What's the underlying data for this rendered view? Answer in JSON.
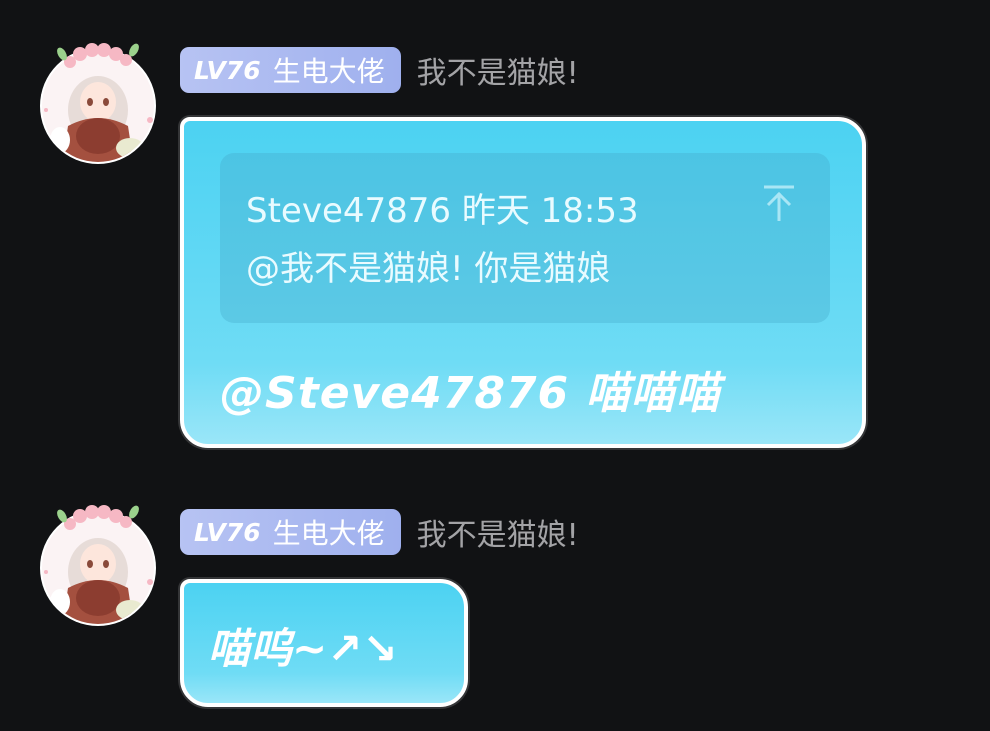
{
  "messages": [
    {
      "sender": {
        "level": "LV76",
        "title": "生电大佬",
        "name": "我不是猫娘!"
      },
      "quote": {
        "author": "Steve47876",
        "time": "昨天 18:53",
        "header": "Steve47876  昨天 18:53",
        "text": "@我不是猫娘!   你是猫娘"
      },
      "text": "@Steve47876 喵喵喵"
    },
    {
      "sender": {
        "level": "LV76",
        "title": "生电大佬",
        "name": "我不是猫娘!"
      },
      "text": "喵呜~↗↘"
    }
  ],
  "colors": {
    "background": "#111214",
    "bubble_top": "#4cd2f2",
    "bubble_bottom": "#9ae6f8",
    "badge": "#a9b8f0",
    "username": "#a3a3a6"
  },
  "icons": {
    "quote_jump": "arrow-up-to-top-icon",
    "avatar": "anime-girl-avatar"
  }
}
